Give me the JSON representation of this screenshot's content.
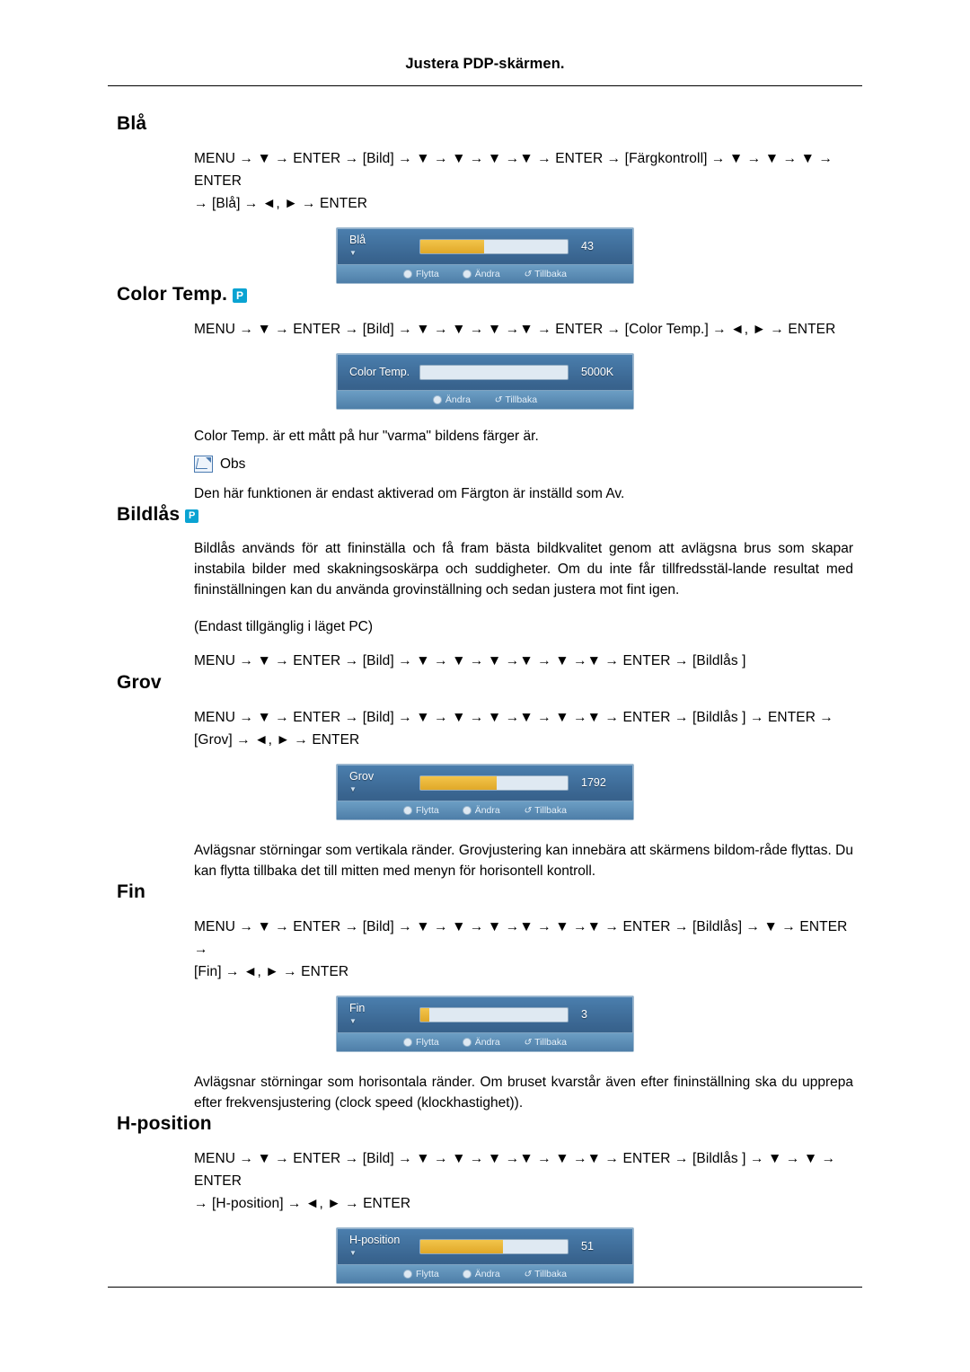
{
  "header": {
    "title": "Justera PDP-skärmen."
  },
  "sections": [
    {
      "id": "bla",
      "title": "Blå",
      "badge": null,
      "path_line1": "MENU → ▼ → ENTER → [Bild] → ▼ → ▼ → ▼ →▼ → ENTER → [Färgkontroll] → ▼ → ▼ → ▼ → ENTER",
      "path_line2": "→ [Blå] → ◄, ► → ENTER",
      "osd": {
        "label": "Blå",
        "value": "43",
        "fill_percent": 43,
        "hints": [
          "Flytta",
          "Ändra",
          "Tillbaka"
        ]
      }
    },
    {
      "id": "color-temp",
      "title": "Color Temp.",
      "badge": "P",
      "path_line1": "MENU → ▼ → ENTER → [Bild] → ▼ → ▼ → ▼ →▼ → ENTER → [Color Temp.] → ◄, ► → ENTER",
      "osd": {
        "label": "Color Temp.",
        "value": "5000K",
        "fill_percent": 0,
        "hints": [
          "Ändra",
          "Tillbaka"
        ]
      },
      "desc": "Color Temp. är ett mått på hur \"varma\" bildens färger är.",
      "note_label": "Obs",
      "note_text": "Den här funktionen är endast aktiverad om Färgton är inställd som Av."
    },
    {
      "id": "bildlas",
      "title": "Bildlås",
      "badge": "P",
      "desc": "Bildlås används för att fininställa och få fram bästa bildkvalitet genom att avlägsna brus som skapar instabila bilder med skakningsoskärpa och suddigheter. Om du inte får tillfredsstäl-lande resultat med fininställningen kan du använda grovinställning och sedan justera mot fint igen.",
      "availability": "(Endast tillgänglig i läget PC)",
      "path_line1": "MENU → ▼ → ENTER → [Bild] → ▼ → ▼ → ▼ →▼ → ▼ →▼ → ENTER → [Bildlås ]"
    },
    {
      "id": "grov",
      "title": "Grov",
      "badge": null,
      "path_line1": "MENU → ▼ → ENTER → [Bild] → ▼ → ▼ → ▼ →▼ → ▼ →▼ → ENTER → [Bildlås ] → ENTER →",
      "path_line2": "[Grov] → ◄, ► → ENTER",
      "osd": {
        "label": "Grov",
        "value": "1792",
        "fill_percent": 52,
        "hints": [
          "Flytta",
          "Ändra",
          "Tillbaka"
        ]
      },
      "desc": "Avlägsnar störningar som vertikala ränder. Grovjustering kan innebära att skärmens bildom-råde flyttas. Du kan flytta tillbaka det till mitten med menyn för horisontell kontroll."
    },
    {
      "id": "fin",
      "title": "Fin",
      "badge": null,
      "path_line1": "MENU → ▼ → ENTER → [Bild] → ▼ → ▼ → ▼ →▼ → ▼ →▼ → ENTER → [Bildlås] → ▼ → ENTER →",
      "path_line2": "[Fin] → ◄, ► → ENTER",
      "osd": {
        "label": "Fin",
        "value": "3",
        "fill_percent": 6,
        "hints": [
          "Flytta",
          "Ändra",
          "Tillbaka"
        ]
      },
      "desc": "Avlägsnar störningar som horisontala ränder. Om bruset kvarstår även efter fininställning ska du upprepa efter frekvensjustering (clock speed (klockhastighet))."
    },
    {
      "id": "h-position",
      "title": "H-position",
      "badge": null,
      "path_line1": "MENU → ▼ → ENTER → [Bild] → ▼ → ▼ → ▼ →▼ → ▼ →▼ → ENTER → [Bildlås ] → ▼ → ▼ → ENTER",
      "path_line2": "→ [H-position] → ◄, ► → ENTER",
      "osd": {
        "label": "H-position",
        "value": "51",
        "fill_percent": 56,
        "hints": [
          "Flytta",
          "Ändra",
          "Tillbaka"
        ]
      }
    }
  ]
}
